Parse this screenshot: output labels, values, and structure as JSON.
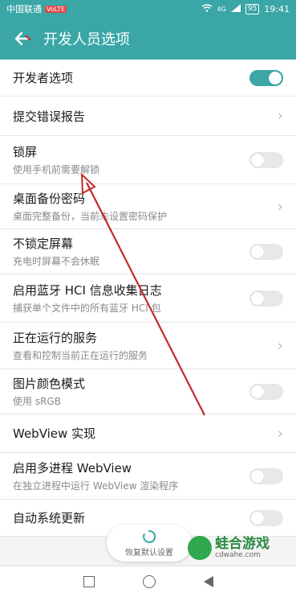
{
  "status_bar": {
    "carrier": "中国联通",
    "carrier_badge": "VoLTE",
    "network": "4G",
    "battery": "95",
    "time": "19:41"
  },
  "app_bar": {
    "title": "开发人员选项"
  },
  "rows": [
    {
      "label": "开发者选项",
      "sub": "",
      "control": "toggle",
      "on": true
    },
    {
      "label": "提交错误报告",
      "sub": "",
      "control": "chevron"
    },
    {
      "label": "锁屏",
      "sub": "使用手机前需要解锁",
      "control": "toggle",
      "on": false
    },
    {
      "label": "桌面备份密码",
      "sub": "桌面完整备份，当前未设置密码保护",
      "control": "chevron"
    },
    {
      "label": "不锁定屏幕",
      "sub": "充电时屏幕不会休眠",
      "control": "toggle",
      "on": false
    },
    {
      "label": "启用蓝牙 HCI 信息收集日志",
      "sub": "捕获单个文件中的所有蓝牙 HCI 包",
      "control": "toggle",
      "on": false
    },
    {
      "label": "正在运行的服务",
      "sub": "查看和控制当前正在运行的服务",
      "control": "chevron"
    },
    {
      "label": "图片颜色模式",
      "sub": "使用 sRGB",
      "control": "toggle",
      "on": false
    },
    {
      "label": "WebView 实现",
      "sub": "",
      "control": "chevron"
    },
    {
      "label": "启用多进程 WebView",
      "sub": "在独立进程中运行 WebView 渲染程序",
      "control": "toggle",
      "on": false
    },
    {
      "label": "自动系统更新",
      "sub": "",
      "control": "toggle",
      "on": false
    }
  ],
  "floating_button": {
    "label": "恢复默认设置"
  },
  "watermark": {
    "title": "蛙合游戏",
    "url": "cdwahe.com"
  },
  "colors": {
    "accent": "#3aa6a6",
    "annotation_arrow": "#c62828"
  }
}
